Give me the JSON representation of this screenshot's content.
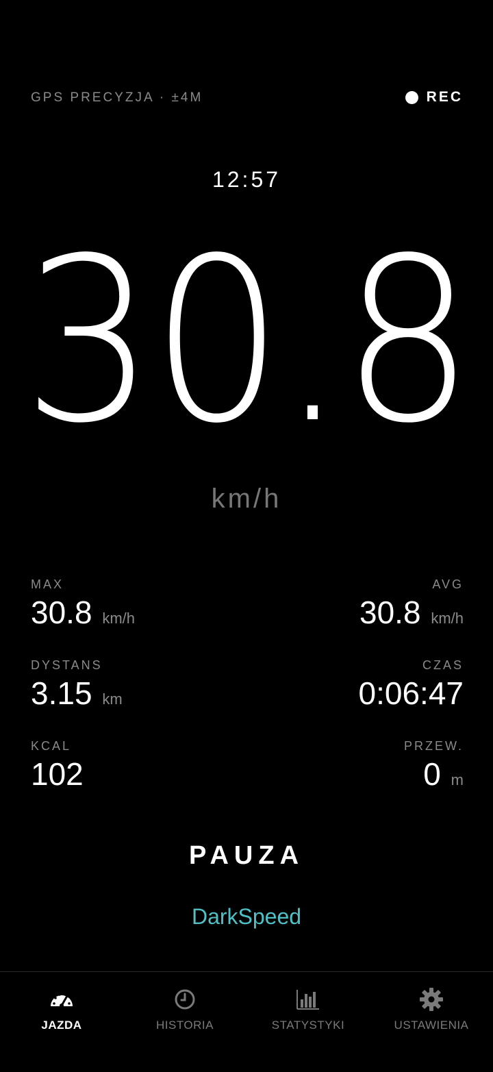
{
  "status": {
    "gps": "GPS PRECYZJA · ±4M",
    "rec": "REC"
  },
  "clock": "12:57",
  "speed": {
    "value": "30.8",
    "unit": "km/h"
  },
  "stats": {
    "max": {
      "label": "MAX",
      "value": "30.8",
      "unit": "km/h"
    },
    "avg": {
      "label": "AVG",
      "value": "30.8",
      "unit": "km/h"
    },
    "distance": {
      "label": "DYSTANS",
      "value": "3.15",
      "unit": "km"
    },
    "time": {
      "label": "CZAS",
      "value": "0:06:47"
    },
    "kcal": {
      "label": "KCAL",
      "value": "102"
    },
    "elevation": {
      "label": "PRZEW.",
      "value": "0",
      "unit": "m"
    }
  },
  "pause_label": "PAUZA",
  "brand": "DarkSpeed",
  "colors": {
    "accent": "#4fc1c6",
    "background": "#000000",
    "muted": "#8a8a8a"
  },
  "nav": [
    {
      "label": "JAZDA",
      "icon": "speedometer-icon",
      "active": true
    },
    {
      "label": "HISTORIA",
      "icon": "clock-icon",
      "active": false
    },
    {
      "label": "STATYSTYKI",
      "icon": "bar-chart-icon",
      "active": false
    },
    {
      "label": "USTAWIENIA",
      "icon": "gear-icon",
      "active": false
    }
  ]
}
